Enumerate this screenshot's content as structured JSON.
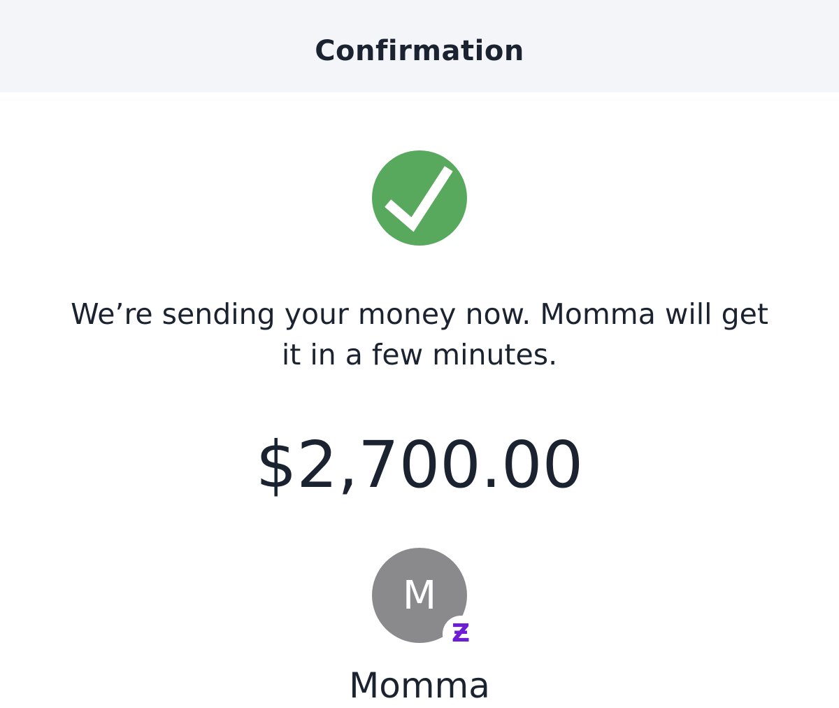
{
  "header": {
    "title": "Confirmation"
  },
  "status": {
    "icon": "checkmark-icon",
    "color": "#58a95e"
  },
  "message": {
    "text": "We’re sending your money now. Momma will get it in a few minutes."
  },
  "payment": {
    "amount": "$2,700.00"
  },
  "recipient": {
    "initial": "M",
    "name": "Momma",
    "avatar_color": "#8a8a8c",
    "badge_icon": "zelle-icon",
    "badge_glyph": "Ƶ",
    "badge_color": "#6d1ed4"
  }
}
